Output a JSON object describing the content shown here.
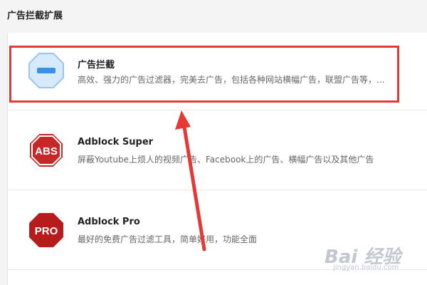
{
  "header": {
    "title": "广告拦截扩展"
  },
  "extensions": [
    {
      "name": "广告拦截",
      "description": "高效、强力的广告过滤器，完美去广告，包括各种网站横幅广告，联盟广告等，...",
      "icon": "octagon-minus-icon",
      "highlighted": true
    },
    {
      "name": "Adblock Super",
      "description": "屏蔽Youtube上烦人的视频广告、Facebook上的广告、横幅广告以及其他广告",
      "icon": "abs-stop-sign-icon",
      "icon_text": "ABS"
    },
    {
      "name": "Adblock Pro",
      "description": "最好的免费广告过滤工具，简单好用，功能全面",
      "icon": "pro-stop-sign-icon",
      "icon_text": "PRO"
    }
  ],
  "annotation": {
    "color": "#e53935",
    "arrow_direction": "up"
  },
  "watermark": {
    "text": "Bai 经验",
    "sub": "jingyan.baidu.com"
  },
  "colors": {
    "highlight": "#e53935",
    "icon_blue": "#cfe6fb",
    "stop_red": "#c62828"
  }
}
